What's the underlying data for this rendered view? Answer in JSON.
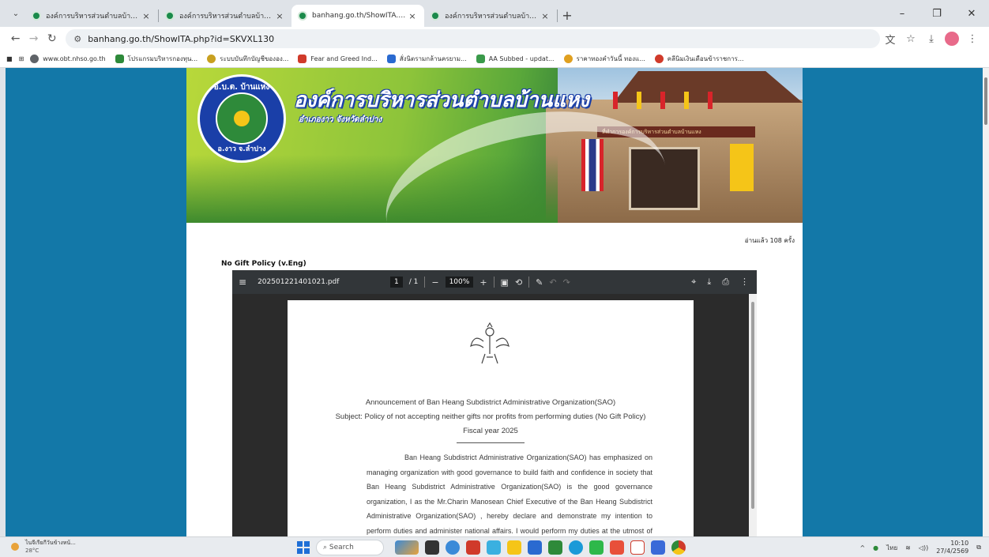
{
  "tabs": [
    {
      "title": "องค์การบริหารส่วนตำบลบ้านแหง อำ",
      "active": false
    },
    {
      "title": "องค์การบริหารส่วนตำบลบ้านแหง อำ",
      "active": false
    },
    {
      "title": "banhang.go.th/ShowITA.php?id",
      "active": true
    },
    {
      "title": "องค์การบริหารส่วนตำบลบ้านแหง อำ",
      "active": false
    }
  ],
  "address": "banhang.go.th/ShowITA.php?id=SKVXL130",
  "bookmarks": [
    {
      "label": "www.obt.nhso.go.th",
      "color": "#5f6368"
    },
    {
      "label": "โปรแกรมบริหารกองทุน...",
      "color": "#2e8a3a"
    },
    {
      "label": "ระบบบันทึกบัญชีขององ...",
      "color": "#c8a020"
    },
    {
      "label": "Fear and Greed Ind...",
      "color": "#d03a2a"
    },
    {
      "label": "สั่งนิตรามกล้านครยาม...",
      "color": "#2a6ad0"
    },
    {
      "label": "AA Subbed - updat...",
      "color": "#3a9a4a"
    },
    {
      "label": "ราคาทองคำวันนี้ ทองแ...",
      "color": "#e0a020"
    },
    {
      "label": "คลีนิมเงินเดือนข้าราชการ...",
      "color": "#d03a2a"
    }
  ],
  "banner": {
    "title": "องค์การบริหารส่วนตำบลบ้านแหง",
    "subtitle": "อำเภองาว จังหวัดลำปาง",
    "seal_top": "อ.บ.ต. บ้านแหง",
    "seal_bottom": "อ.งาว จ.ลำปาง",
    "sign": "ที่ทำการองค์การบริหารส่วนตำบลบ้านแหง"
  },
  "read_count": "อ่านแล้ว 108 ครั้ง",
  "doc_label": "No Gift Policy (v.Eng)",
  "pdf": {
    "filename": "202501221401021.pdf",
    "page_current": "1",
    "page_total": "/ 1",
    "zoom": "100%"
  },
  "document": {
    "line1": "Announcement of Ban Heang Subdistrict Administrative Organization(SAO)",
    "line2": "Subject: Policy of not accepting neither gifts nor profits from performing duties (No Gift Policy)",
    "line3": "Fiscal year 2025",
    "body": "Ban Heang Subdistrict Administrative Organization(SAO) has emphasized on managing organization with good governance to build faith and confidence in society that Ban Heang Subdistrict Administrative Organization(SAO) is the good governance organization, I as the Mr.Charin Manosean Chief Executive of the Ban Heang Subdistrict Administrative Organization(SAO) , hereby declare and demonstrate my intention to perform duties and administer national affairs. I would perform my duties at the utmost of my ability with"
  },
  "taskbar": {
    "weather_text": "ไนจีเรียกีวันข้างหน้...",
    "temp": "28°C",
    "search_placeholder": "Search",
    "language": "ไทย",
    "time": "10:10",
    "date": "27/4/2569"
  }
}
